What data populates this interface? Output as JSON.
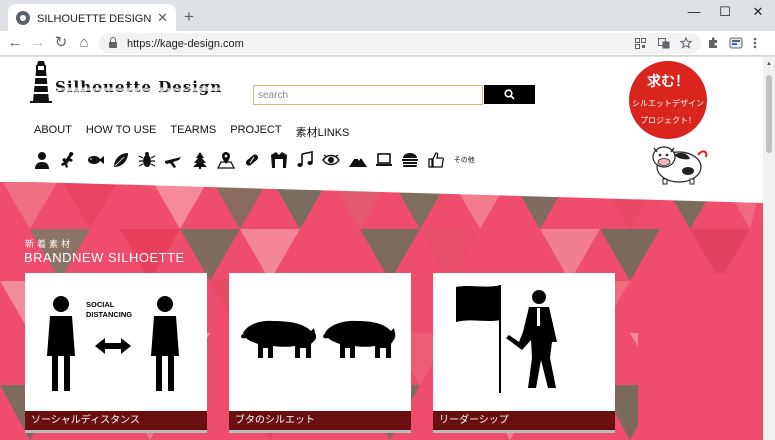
{
  "browser": {
    "tab_title": "SILHOUETTE DESIGN – シルエ",
    "tab_close": "✕",
    "new_tab": "+",
    "url": "https://kage-design.com",
    "window_controls": [
      "—",
      "☐",
      "✕"
    ],
    "nav": {
      "back": "←",
      "forward": "→",
      "reload": "↻",
      "home": "⌂"
    },
    "toolbar_icons": [
      "qr-code-icon",
      "translate-icon",
      "star-icon",
      "extensions-icon",
      "profile-icon",
      "menu-icon"
    ]
  },
  "site": {
    "logo_text": "Silhouette Design",
    "search": {
      "placeholder": "search"
    },
    "menu": [
      "ABOUT",
      "HOW TO USE",
      "TEARMS",
      "PROJECT",
      "素材LINKS"
    ],
    "categories": [
      "person-icon",
      "lizard-icon",
      "fish-icon",
      "leaf-icon",
      "insect-icon",
      "airplane-icon",
      "christmas-tree-icon",
      "map-pin-icon",
      "pill-icon",
      "jacket-icon",
      "music-note-icon",
      "eye-icon",
      "mountain-icon",
      "laptop-icon",
      "burger-icon",
      "thumbs-up-icon"
    ],
    "categories_more": "その他",
    "badge": {
      "title": "求む！",
      "line2": "シルエットデザイン",
      "line3": "プロジェクト！"
    },
    "section": {
      "jp": "新着素材",
      "en": "BRANDNEW SILHOETTE"
    },
    "cards": [
      {
        "caption": "ソーシャルディスタンス",
        "img_text_1": "SOCIAL",
        "img_text_2": "DISTANCING"
      },
      {
        "caption": "ブタのシルエット"
      },
      {
        "caption": "リーダーシップ"
      }
    ]
  },
  "colors": {
    "hero_pink": "#ee4d6b",
    "caption_bg": "#6a0f0f",
    "badge_red": "#d9251d"
  }
}
